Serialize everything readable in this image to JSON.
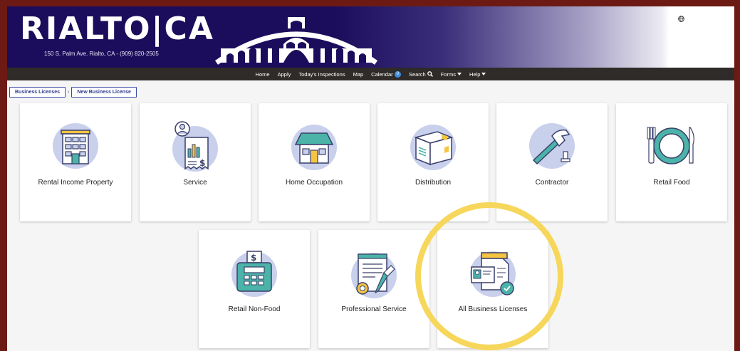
{
  "header": {
    "logo_text": "RIALTO|CA",
    "address": "150 S. Palm Ave. Rialto, CA - (909) 820-2505",
    "language_icon": "globe-icon"
  },
  "nav": {
    "items": [
      "Home",
      "Apply",
      "Today's Inspections",
      "Map",
      "Calendar",
      "Search",
      "Forms",
      "Help"
    ],
    "calendar_count": "0"
  },
  "breadcrumbs": [
    "Business Licenses",
    "New Business License"
  ],
  "cards": [
    {
      "label": "Rental Income Property",
      "icon": "building-icon"
    },
    {
      "label": "Service",
      "icon": "service-receipt-icon"
    },
    {
      "label": "Home Occupation",
      "icon": "house-icon"
    },
    {
      "label": "Distribution",
      "icon": "box-icon"
    },
    {
      "label": "Contractor",
      "icon": "hammer-icon"
    },
    {
      "label": "Retail Food",
      "icon": "plate-utensils-icon"
    },
    {
      "label": "Retail Non-Food",
      "icon": "cash-register-icon"
    },
    {
      "label": "Professional Service",
      "icon": "document-pen-icon"
    },
    {
      "label": "All Business Licenses",
      "icon": "license-card-icon"
    }
  ],
  "colors": {
    "banner": "#1c0d5c",
    "navbar": "#2e2b28",
    "icon_circle": "#c9d0ec",
    "accent_teal": "#4bb3a8",
    "accent_yellow": "#f5c542",
    "highlight_ring": "#f6d75b",
    "frame": "#6e1a14"
  }
}
